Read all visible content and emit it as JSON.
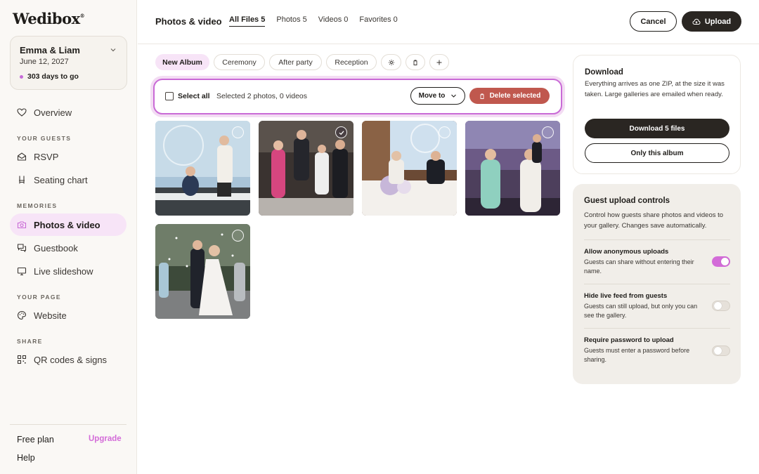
{
  "app": {
    "logo": "Wedibox"
  },
  "event": {
    "name": "Emma & Liam",
    "date": "June 12, 2027",
    "countdown": "303 days to go"
  },
  "sidebar": {
    "overview": "Overview",
    "section_guests": "YOUR GUESTS",
    "rsvp": "RSVP",
    "seating": "Seating chart",
    "section_memories": "MEMORIES",
    "photos": "Photos & video",
    "guestbook": "Guestbook",
    "slideshow": "Live slideshow",
    "section_page": "YOUR PAGE",
    "website": "Website",
    "section_share": "SHARE",
    "qr": "QR codes & signs",
    "plan": "Free plan",
    "upgrade": "Upgrade",
    "help": "Help"
  },
  "header": {
    "title": "Photos & video",
    "tabs": [
      {
        "label": "All Files 5"
      },
      {
        "label": "Photos 5"
      },
      {
        "label": "Videos 0"
      },
      {
        "label": "Favorites 0"
      }
    ],
    "cancel": "Cancel",
    "upload": "Upload"
  },
  "albums": {
    "new": "New Album",
    "items": [
      "Ceremony",
      "After party",
      "Reception"
    ]
  },
  "selection": {
    "select_all": "Select all",
    "summary": "Selected 2 photos, 0 videos",
    "move": "Move to",
    "delete": "Delete selected"
  },
  "photos": [
    {
      "name": "speech-photo",
      "selected": false
    },
    {
      "name": "dance-photo",
      "selected": true
    },
    {
      "name": "head-table-photo",
      "selected": false
    },
    {
      "name": "party-dance-photo",
      "selected": false
    },
    {
      "name": "confetti-exit-photo",
      "selected": false
    }
  ],
  "download": {
    "title": "Download",
    "desc": "Everything arrives as one ZIP, at the size it was taken. Large galleries are emailed when ready.",
    "primary": "Download 5 files",
    "secondary": "Only this album"
  },
  "guest_upload": {
    "title": "Guest upload controls",
    "desc": "Control how guests share photos and videos to your gallery. Changes save automatically.",
    "settings": [
      {
        "title": "Allow anonymous uploads",
        "desc": "Guests can share without entering their name.",
        "on": true
      },
      {
        "title": "Hide live feed from guests",
        "desc": "Guests can still upload, but only you can see the gallery.",
        "on": false
      },
      {
        "title": "Require password to upload",
        "desc": "Guests must enter a password before sharing.",
        "on": false
      }
    ]
  },
  "colors": {
    "accent": "#d36bd8",
    "danger": "#c0584e",
    "dark": "#2a2622"
  }
}
